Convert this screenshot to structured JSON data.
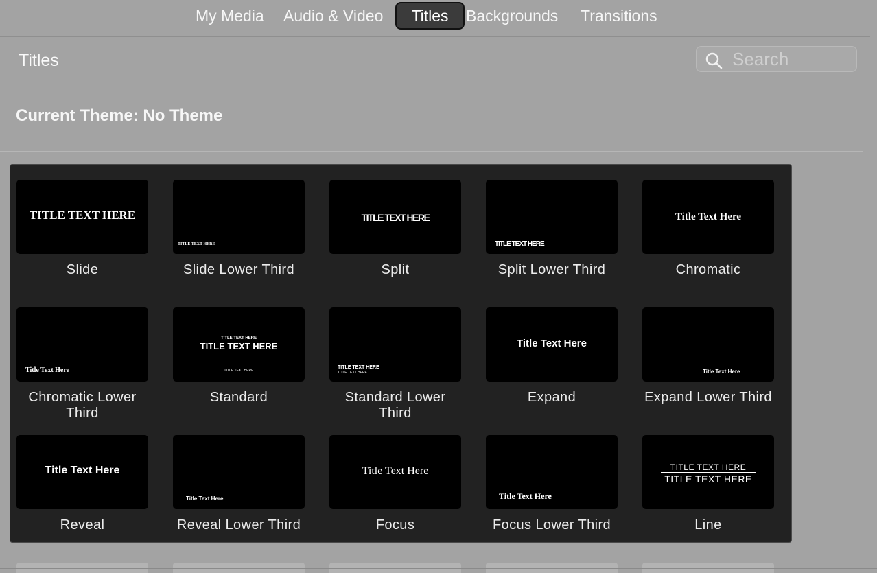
{
  "tabs": [
    {
      "label": "My Media"
    },
    {
      "label": "Audio & Video"
    },
    {
      "label": "Titles"
    },
    {
      "label": "Backgrounds"
    },
    {
      "label": "Transitions"
    }
  ],
  "header": {
    "title": "Titles",
    "search_placeholder": "Search"
  },
  "current_theme": "Current Theme: No Theme",
  "tiles": [
    {
      "label": "Slide",
      "preview": [
        "TITLE TEXT HERE"
      ]
    },
    {
      "label": "Slide Lower Third",
      "preview": [
        "TITLE TEXT HERE"
      ]
    },
    {
      "label": "Split",
      "preview": [
        "TITLE TEXT HERE"
      ]
    },
    {
      "label": "Split Lower Third",
      "preview": [
        "TITLE TEXT HERE"
      ]
    },
    {
      "label": "Chromatic",
      "preview": [
        "Title Text Here"
      ]
    },
    {
      "label": "Chromatic Lower Third",
      "preview": [
        "Title Text Here"
      ]
    },
    {
      "label": "Standard",
      "preview": [
        "TITLE TEXT HERE",
        "TITLE TEXT HERE",
        "TITLE TEXT HERE"
      ]
    },
    {
      "label": "Standard Lower Third",
      "preview": [
        "TITLE TEXT HERE",
        "TITLE TEXT HERE"
      ]
    },
    {
      "label": "Expand",
      "preview": [
        "Title Text Here"
      ]
    },
    {
      "label": "Expand Lower Third",
      "preview": [
        "Title Text Here"
      ]
    },
    {
      "label": "Reveal",
      "preview": [
        "Title Text Here"
      ]
    },
    {
      "label": "Reveal Lower Third",
      "preview": [
        "Title Text Here"
      ]
    },
    {
      "label": "Focus",
      "preview": [
        "Title Text Here"
      ]
    },
    {
      "label": "Focus Lower Third",
      "preview": [
        "Title Text Here"
      ]
    },
    {
      "label": "Line",
      "preview": [
        "TITLE TEXT HERE",
        "TITLE TEXT HERE"
      ]
    }
  ],
  "colors": {
    "background": "#a3a3a3",
    "panel": "#222222",
    "thumbnail": "#000000",
    "active_tab": "#3b3b3b"
  }
}
